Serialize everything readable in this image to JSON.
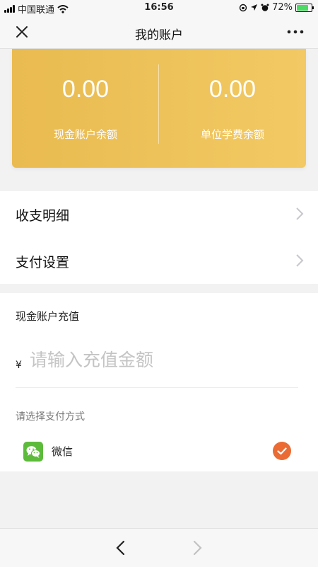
{
  "status_bar": {
    "carrier": "中国联通",
    "time": "16:56",
    "battery": "72%"
  },
  "nav": {
    "title": "我的账户",
    "close_icon": "close-icon",
    "more_icon": "more-icon"
  },
  "balance": {
    "cash_amount": "0.00",
    "cash_label": "现金账户余额",
    "unit_amount": "0.00",
    "unit_label": "单位学费余额"
  },
  "menu": {
    "items": [
      {
        "label": "收支明细",
        "icon": "chevron-right-icon"
      },
      {
        "label": "支付设置",
        "icon": "chevron-right-icon"
      }
    ]
  },
  "recharge": {
    "title": "现金账户充值",
    "currency": "¥",
    "amount_value": "",
    "amount_placeholder": "请输入充值金额",
    "pay_method_label": "请选择支付方式",
    "pay_method": {
      "name": "微信",
      "icon": "wechat-icon",
      "selected": true
    }
  },
  "colors": {
    "card_gradient_start": "#e9bb50",
    "card_gradient_end": "#f2c964",
    "check_color": "#eb6b34",
    "wechat_green": "#5dbb3c"
  }
}
